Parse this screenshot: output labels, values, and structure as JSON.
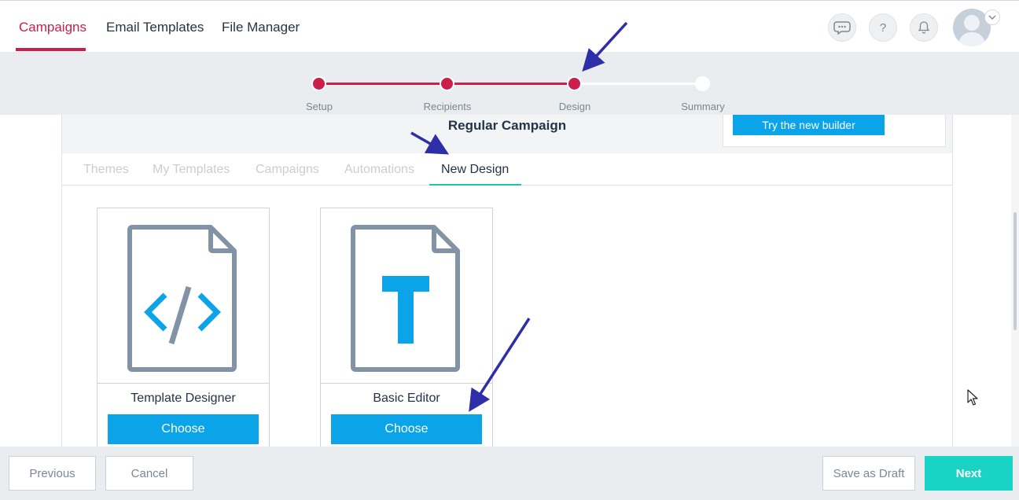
{
  "nav": {
    "tabs": [
      {
        "label": "Campaigns",
        "active": true
      },
      {
        "label": "Email Templates",
        "active": false
      },
      {
        "label": "File Manager",
        "active": false
      }
    ],
    "help_glyph": "?",
    "icons": [
      "chat-icon",
      "help-icon",
      "bell-icon",
      "avatar",
      "chevron-down-icon"
    ]
  },
  "stepper": {
    "steps": [
      {
        "label": "Setup",
        "state": "done"
      },
      {
        "label": "Recipients",
        "state": "done"
      },
      {
        "label": "Design",
        "state": "current"
      },
      {
        "label": "Summary",
        "state": "pending"
      }
    ]
  },
  "header": {
    "title": "Regular Campaign",
    "builder_button": "Try the new builder"
  },
  "design_tabs": [
    {
      "label": "Themes",
      "active": false
    },
    {
      "label": "My Templates",
      "active": false
    },
    {
      "label": "Campaigns",
      "active": false
    },
    {
      "label": "Automations",
      "active": false
    },
    {
      "label": "New Design",
      "active": true
    }
  ],
  "cards": [
    {
      "title": "Template Designer",
      "button": "Choose",
      "icon": "code-file-icon"
    },
    {
      "title": "Basic Editor",
      "button": "Choose",
      "icon": "text-file-icon"
    }
  ],
  "footer": {
    "previous": "Previous",
    "cancel": "Cancel",
    "save_draft": "Save as Draft",
    "next": "Next"
  },
  "colors": {
    "accent_red": "#cc1e4a",
    "button_blue": "#0ca4e9",
    "next_teal": "#19d3c5",
    "tab_underline": "#1bc7b1",
    "annotation_arrow": "#2e2ea8"
  }
}
